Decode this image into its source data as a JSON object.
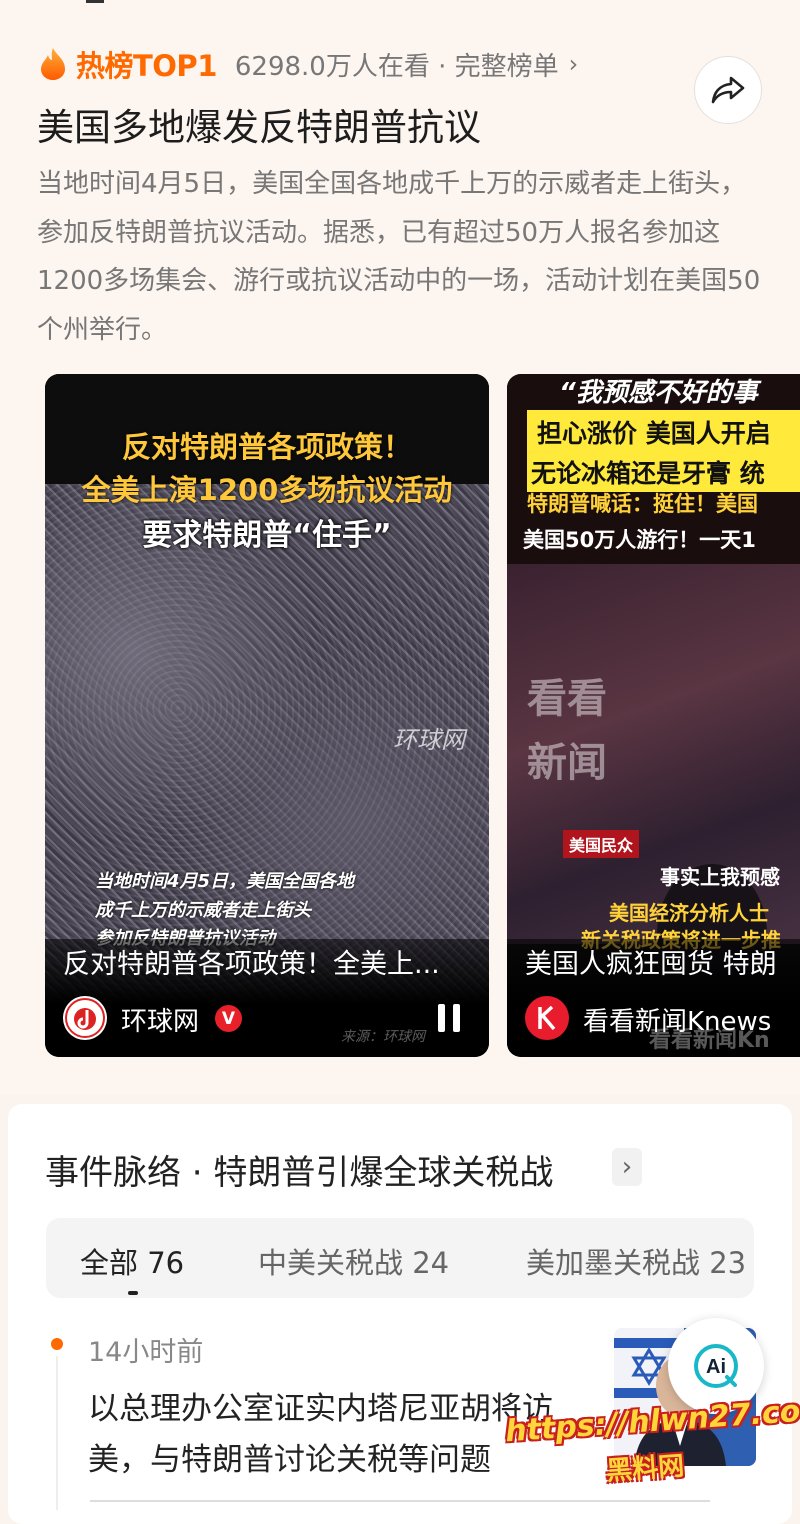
{
  "hot": {
    "label": "热榜TOP1",
    "viewers": "6298.0万人在看 · 完整榜单",
    "arrow": "›"
  },
  "headline": "美国多地爆发反特朗普抗议",
  "summary": "当地时间4月5日，美国全国各地成千上万的示威者走上街头，参加反特朗普抗议活动。据悉，已有超过50万人报名参加这1200多场集会、游行或抗议活动中的一场，活动计划在美国50个州举行。",
  "videos": [
    {
      "caption_line1": "反对特朗普各项政策！",
      "caption_line2": "全美上演1200多场抗议活动",
      "caption_line3": "要求特朗普“住手”",
      "watermark": "环球网",
      "subtitle_line1": "当地时间4月5日，美国全国各地",
      "subtitle_line2": "成千上万的示威者走上街头",
      "subtitle_line3": "参加反特朗普抗议活动",
      "title": "反对特朗普各项政策！全美上...",
      "author": "环球网",
      "verified_mark": "V",
      "source": "来源：环球网"
    },
    {
      "caption_top": "“我预感不好的事",
      "caption_line1": "担心涨价 美国人开启",
      "caption_line2": "无论冰箱还是牙膏 统",
      "caption_line3": "特朗普喊话：挺住！美国",
      "caption_line4": "美国50万人游行！一天1",
      "logo_line1": "看看",
      "logo_line2": "新闻",
      "tag": "美国民众",
      "sub1": "事实上我预感",
      "sub2": "美国经济分析人士",
      "sub3": "新关税政策将进一步推",
      "title": "美国人疯狂囤货 特朗",
      "author": "看看新闻Knews",
      "bottom_wm": "看看新闻Kn"
    }
  ],
  "event": {
    "title": "事件脉络 · 特朗普引爆全球关税战",
    "arrow": "›",
    "tabs": [
      {
        "label": "全部",
        "count": "76"
      },
      {
        "label": "中美关税战",
        "count": "24"
      },
      {
        "label": "美加墨关税战",
        "count": "23"
      }
    ],
    "items": [
      {
        "time": "14小时前",
        "text": "以总理办公室证实内塔尼亚胡将访美，与特朗普讨论关税等问题"
      }
    ]
  },
  "ai_button": "Ai",
  "watermark": {
    "line1": "https://hlwn27.com",
    "line2": "黑料网"
  },
  "colors": {
    "accent": "#ff6a00",
    "caption_yellow": "#ffc83a",
    "verify_red": "#e8202a"
  }
}
